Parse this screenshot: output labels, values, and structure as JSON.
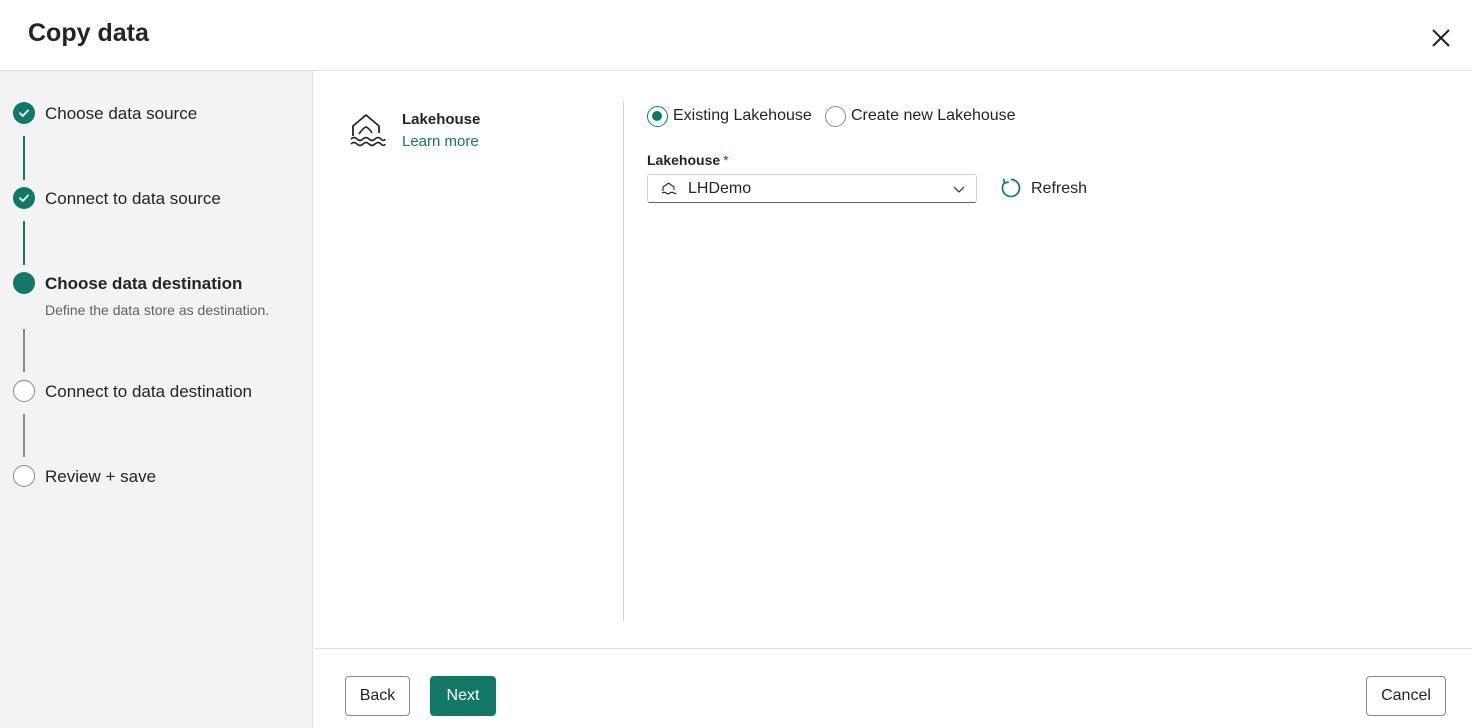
{
  "dialog": {
    "title": "Copy data"
  },
  "steps": [
    {
      "label": "Choose data source",
      "state": "done"
    },
    {
      "label": "Connect to data source",
      "state": "done"
    },
    {
      "label": "Choose data destination",
      "description": "Define the data store as destination.",
      "state": "current"
    },
    {
      "label": "Connect to data destination",
      "state": "todo"
    },
    {
      "label": "Review + save",
      "state": "todo"
    }
  ],
  "destination": {
    "name": "Lakehouse",
    "learn_more": "Learn more",
    "icon": "lakehouse-icon"
  },
  "mode": {
    "options": [
      "Existing Lakehouse",
      "Create new Lakehouse"
    ],
    "selected": "Existing Lakehouse"
  },
  "lakehouse_field": {
    "label": "Lakehouse",
    "required_mark": "*",
    "value": "LHDemo"
  },
  "refresh": {
    "label": "Refresh"
  },
  "footer": {
    "back": "Back",
    "next": "Next",
    "cancel": "Cancel"
  },
  "colors": {
    "accent": "#117865",
    "required": "#c50f1f",
    "sidebar_bg": "#f3f3f3"
  }
}
